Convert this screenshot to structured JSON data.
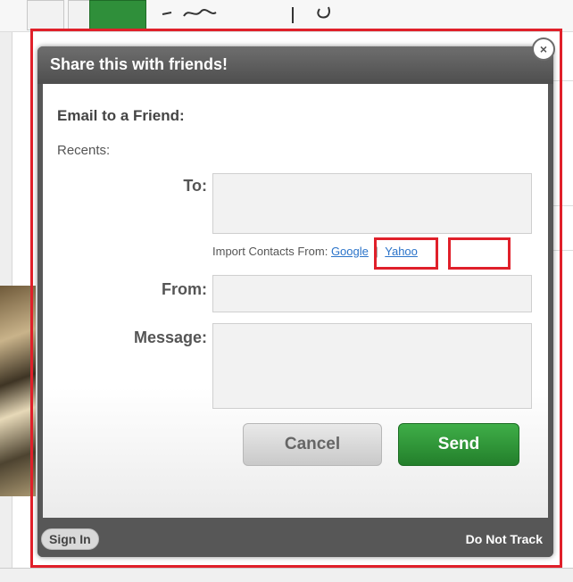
{
  "modal": {
    "title": "Share this with friends!",
    "close_glyph": "×"
  },
  "email_form": {
    "section_title": "Email to a Friend:",
    "recents_label": "Recents:",
    "to_label": "To:",
    "to_value": "",
    "import_prefix": "Import Contacts From:",
    "import_sources": [
      "Google",
      "Yahoo"
    ],
    "import_separator": "|",
    "from_label": "From:",
    "from_value": "",
    "message_label": "Message:",
    "message_value": ""
  },
  "buttons": {
    "cancel_label": "Cancel",
    "send_label": "Send"
  },
  "footer": {
    "sign_in_label": "Sign In",
    "do_not_track_label": "Do Not Track"
  },
  "colors": {
    "highlight": "#e0202a",
    "send_button": "#2f9a38",
    "link": "#2a73c9",
    "modal_frame": "#575757"
  }
}
